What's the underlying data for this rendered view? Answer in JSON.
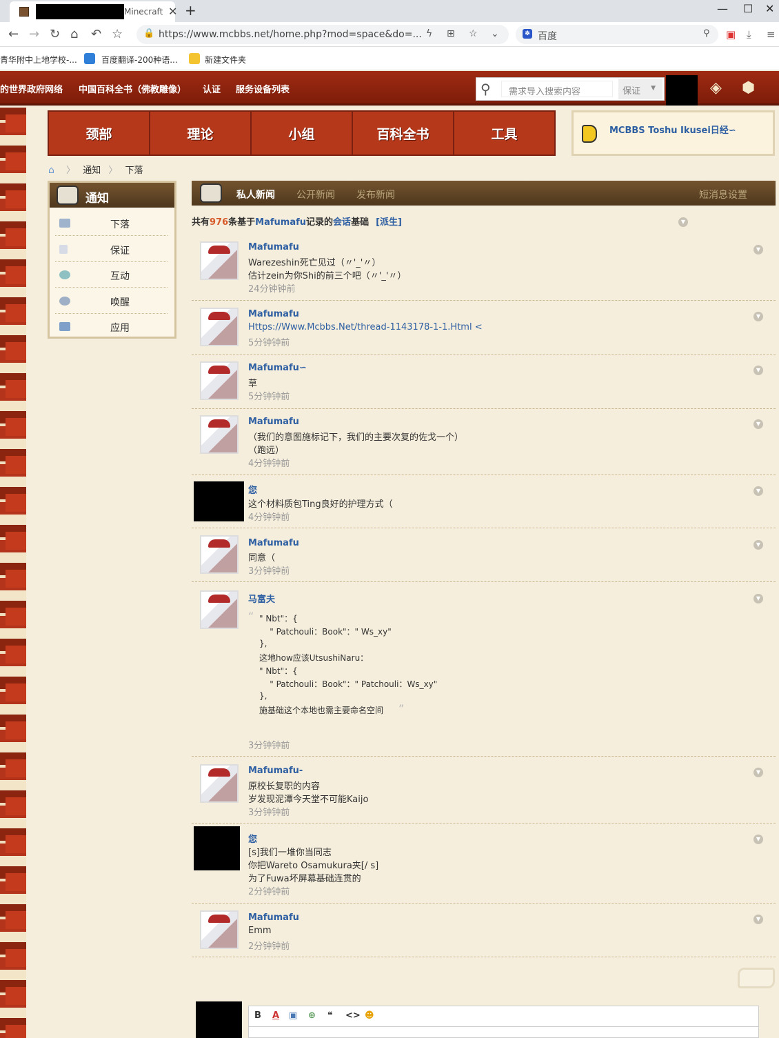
{
  "browser": {
    "tab_title": "Minecraft",
    "url": "https://www.mcbbs.net/home.php?mod=space&do=...",
    "search_placeholder": "百度"
  },
  "bookmarks": [
    {
      "label": "青华附中上地学校-..."
    },
    {
      "label": "百度翻译-200种语..."
    },
    {
      "label": "新建文件夹"
    }
  ],
  "site": {
    "top_nav": [
      "的世界政府网络",
      "中国百科全书（佛教雕像）",
      "认证",
      "服务设备列表"
    ],
    "search_placeholder": "需求导入搜索内容",
    "search_select": "保证"
  },
  "main_nav": [
    "颈部",
    "理论",
    "小组",
    "百科全书",
    "工具"
  ],
  "announcement": "MCBBS Toshu Ikusei日经∽",
  "breadcrumb": [
    "通知",
    "下落"
  ],
  "left_panel": {
    "title": "通知",
    "items": [
      {
        "label": "下落",
        "icon": "mail-icon"
      },
      {
        "label": "保证",
        "icon": "document-icon"
      },
      {
        "label": "互动",
        "icon": "recycle-icon"
      },
      {
        "label": "唤醒",
        "icon": "gear-icon"
      },
      {
        "label": "应用",
        "icon": "grid-icon"
      }
    ]
  },
  "content_tabs": {
    "active": "私人新闻",
    "others": [
      "公开新闻",
      "发布新闻"
    ],
    "settings": "短消息设置"
  },
  "summary": {
    "prefix": "共有",
    "count": "976",
    "mid": "条基于",
    "user": "Mafumafu",
    "suffix": "记录的",
    "link": "会话",
    "tail": "基础",
    "derive": "[派生]"
  },
  "messages": [
    {
      "name": "Mafumafu",
      "lines": [
        "Warezeshin死亡见过（〃'_'〃）",
        "估计zein为你Shi的前三个吧（〃'_'〃）"
      ],
      "time": "24分钟钟前"
    },
    {
      "name": "Mafumafu",
      "lines": [
        "Https://Www.Mcbbs.Net/thread-1143178-1-1.Html <"
      ],
      "time": "5分钟钟前"
    },
    {
      "name": "Mafumafu∽",
      "lines": [
        "草"
      ],
      "time": "5分钟钟前"
    },
    {
      "name": "Mafumafu",
      "lines": [
        "（我们的意图施标记下，我们的主要次复的佐戈一个）",
        "（跑远）"
      ],
      "time": "4分钟钟前"
    },
    {
      "name": "您",
      "lines": [
        "这个材料质包Ting良好的护理方式（"
      ],
      "time": "4分钟钟前"
    },
    {
      "name": "Mafumafu",
      "lines": [
        "同意（"
      ],
      "time": "3分钟钟前"
    },
    {
      "name": "马富夫",
      "quote": [
        "\" Nbt\"：{",
        "    \" Patchouli：Book\"：\" Ws_xy\"",
        "},",
        "这地how应该UtsushiNaru：",
        "\" Nbt\"：{",
        "    \" Patchouli：Book\"：\" Patchouli：Ws_xy\"",
        "},",
        "施基础这个本地也需主要命名空间"
      ],
      "time": "3分钟钟前"
    },
    {
      "name": "Mafumafu-",
      "lines": [
        "原校长复职的内容",
        "岁发现泥潭今天堂不可能Kaijo"
      ],
      "time": "3分钟钟前"
    },
    {
      "name": "您",
      "lines": [
        "[s]我们一堆你当同志",
        "你把Wareto Osamukura夹[/ s]",
        "为了Fuwa坏屏幕基础连贯的"
      ],
      "time": "2分钟钟前"
    },
    {
      "name": "Mafumafu",
      "lines": [
        "Emm"
      ],
      "time": "2分钟钟前"
    }
  ],
  "editor": {
    "bold": "B",
    "color": "A",
    "quote": "❝",
    "code": "<>"
  }
}
